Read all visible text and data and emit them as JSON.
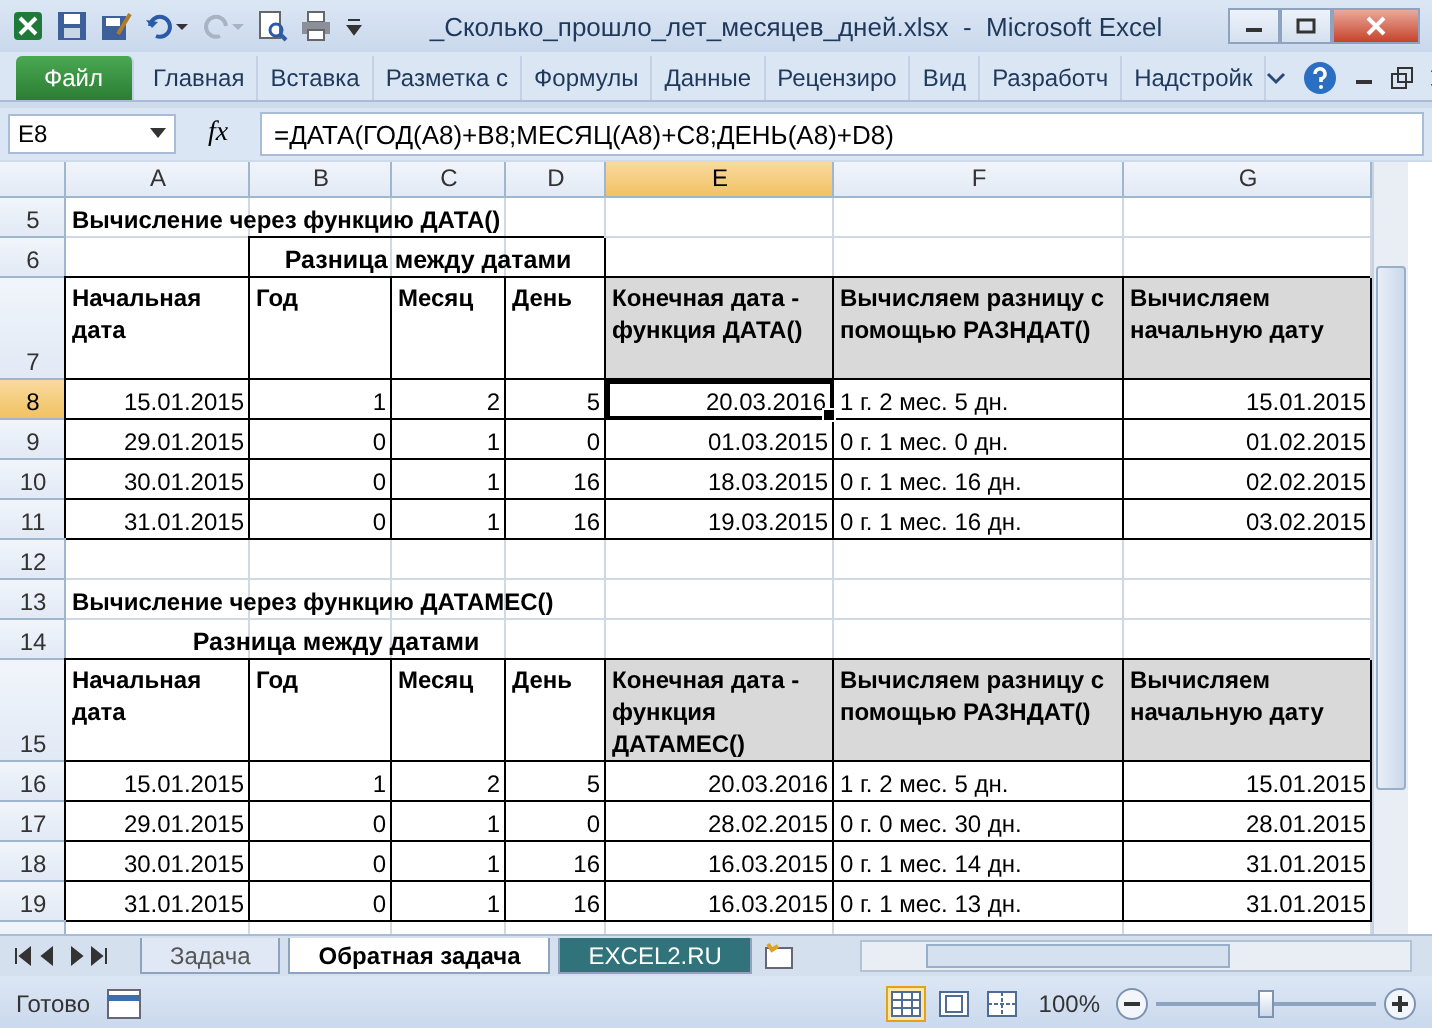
{
  "window": {
    "title": "_Сколько_прошло_лет_месяцев_дней.xlsx  -  Microsoft Excel"
  },
  "ribbon_tabs": [
    {
      "label": "Файл",
      "kind": "file",
      "selected": false
    },
    {
      "label": "Главная",
      "kind": "tab",
      "selected": false
    },
    {
      "label": "Вставка",
      "kind": "tab",
      "selected": false
    },
    {
      "label": "Разметка с",
      "kind": "tab",
      "selected": false
    },
    {
      "label": "Формулы",
      "kind": "tab",
      "selected": false
    },
    {
      "label": "Данные",
      "kind": "tab",
      "selected": false
    },
    {
      "label": "Рецензиро",
      "kind": "tab",
      "selected": false
    },
    {
      "label": "Вид",
      "kind": "tab",
      "selected": false
    },
    {
      "label": "Разработч",
      "kind": "tab",
      "selected": false
    },
    {
      "label": "Надстройк",
      "kind": "tab",
      "selected": false
    }
  ],
  "formula_bar": {
    "name_box": "E8",
    "fx": "fx",
    "formula": "=ДАТА(ГОД(A8)+B8;МЕСЯЦ(A8)+C8;ДЕНЬ(A8)+D8)"
  },
  "columns": [
    {
      "label": "A",
      "selected": false
    },
    {
      "label": "B",
      "selected": false
    },
    {
      "label": "C",
      "selected": false
    },
    {
      "label": "D",
      "selected": false
    },
    {
      "label": "E",
      "selected": true
    },
    {
      "label": "F",
      "selected": false
    },
    {
      "label": "G",
      "selected": false
    }
  ],
  "rows": [
    {
      "number": "5",
      "kind": "title",
      "selected": false,
      "text": "Вычисление через функцию ДАТА()"
    },
    {
      "number": "6",
      "kind": "group_boxed",
      "selected": false,
      "text": "Разница между датами"
    },
    {
      "number": "7",
      "kind": "header",
      "selected": false,
      "cells": [
        {
          "text": "Начальная дата",
          "shaded": false
        },
        {
          "text": "Год",
          "shaded": false
        },
        {
          "text": "Месяц",
          "shaded": false
        },
        {
          "text": "День",
          "shaded": false
        },
        {
          "text": "Конечная дата - функция ДАТА()",
          "shaded": true
        },
        {
          "text": "Вычисляем разницу с помощью РАЗНДАТ()",
          "shaded": true
        },
        {
          "text": "Вычисляем начальную дату",
          "shaded": true
        }
      ]
    },
    {
      "number": "8",
      "kind": "data",
      "selected": true,
      "cells": [
        {
          "text": "15.01.2015",
          "selected": false
        },
        {
          "text": "1",
          "selected": false
        },
        {
          "text": "2",
          "selected": false
        },
        {
          "text": "5",
          "selected": false
        },
        {
          "text": "20.03.2016",
          "selected": true
        },
        {
          "text": "1 г. 2 мес. 5 дн.",
          "selected": false
        },
        {
          "text": "15.01.2015",
          "selected": false
        }
      ]
    },
    {
      "number": "9",
      "kind": "data",
      "selected": false,
      "cells": [
        {
          "text": "29.01.2015",
          "selected": false
        },
        {
          "text": "0",
          "selected": false
        },
        {
          "text": "1",
          "selected": false
        },
        {
          "text": "0",
          "selected": false
        },
        {
          "text": "01.03.2015",
          "selected": false
        },
        {
          "text": "0 г. 1 мес. 0 дн.",
          "selected": false
        },
        {
          "text": "01.02.2015",
          "selected": false
        }
      ]
    },
    {
      "number": "10",
      "kind": "data",
      "selected": false,
      "cells": [
        {
          "text": "30.01.2015",
          "selected": false
        },
        {
          "text": "0",
          "selected": false
        },
        {
          "text": "1",
          "selected": false
        },
        {
          "text": "16",
          "selected": false
        },
        {
          "text": "18.03.2015",
          "selected": false
        },
        {
          "text": "0 г. 1 мес. 16 дн.",
          "selected": false
        },
        {
          "text": "02.02.2015",
          "selected": false
        }
      ]
    },
    {
      "number": "11",
      "kind": "data",
      "selected": false,
      "cells": [
        {
          "text": "31.01.2015",
          "selected": false
        },
        {
          "text": "0",
          "selected": false
        },
        {
          "text": "1",
          "selected": false
        },
        {
          "text": "16",
          "selected": false
        },
        {
          "text": "19.03.2015",
          "selected": false
        },
        {
          "text": "0 г. 1 мес. 16 дн.",
          "selected": false
        },
        {
          "text": "03.02.2015",
          "selected": false
        }
      ]
    },
    {
      "number": "12",
      "kind": "empty",
      "selected": false
    },
    {
      "number": "13",
      "kind": "title",
      "selected": false,
      "text": "Вычисление через функцию ДАТАМЕС()"
    },
    {
      "number": "14",
      "kind": "group",
      "selected": false,
      "text": "Разница между датами"
    },
    {
      "number": "15",
      "kind": "header",
      "selected": false,
      "cells": [
        {
          "text": "Начальная дата",
          "shaded": false
        },
        {
          "text": "Год",
          "shaded": false
        },
        {
          "text": "Месяц",
          "shaded": false
        },
        {
          "text": "День",
          "shaded": false
        },
        {
          "text": "Конечная дата - функция ДАТАМЕС()",
          "shaded": true
        },
        {
          "text": "Вычисляем разницу с помощью РАЗНДАТ()",
          "shaded": true
        },
        {
          "text": "Вычисляем начальную дату",
          "shaded": true
        }
      ]
    },
    {
      "number": "16",
      "kind": "data",
      "selected": false,
      "cells": [
        {
          "text": "15.01.2015",
          "selected": false
        },
        {
          "text": "1",
          "selected": false
        },
        {
          "text": "2",
          "selected": false
        },
        {
          "text": "5",
          "selected": false
        },
        {
          "text": "20.03.2016",
          "selected": false
        },
        {
          "text": "1 г. 2 мес. 5 дн.",
          "selected": false
        },
        {
          "text": "15.01.2015",
          "selected": false
        }
      ]
    },
    {
      "number": "17",
      "kind": "data",
      "selected": false,
      "cells": [
        {
          "text": "29.01.2015",
          "selected": false
        },
        {
          "text": "0",
          "selected": false
        },
        {
          "text": "1",
          "selected": false
        },
        {
          "text": "0",
          "selected": false
        },
        {
          "text": "28.02.2015",
          "selected": false
        },
        {
          "text": "0 г. 0 мес. 30 дн.",
          "selected": false
        },
        {
          "text": "28.01.2015",
          "selected": false
        }
      ]
    },
    {
      "number": "18",
      "kind": "data",
      "selected": false,
      "cells": [
        {
          "text": "30.01.2015",
          "selected": false
        },
        {
          "text": "0",
          "selected": false
        },
        {
          "text": "1",
          "selected": false
        },
        {
          "text": "16",
          "selected": false
        },
        {
          "text": "16.03.2015",
          "selected": false
        },
        {
          "text": "0 г. 1 мес. 14 дн.",
          "selected": false
        },
        {
          "text": "31.01.2015",
          "selected": false
        }
      ]
    },
    {
      "number": "19",
      "kind": "data",
      "selected": false,
      "cells": [
        {
          "text": "31.01.2015",
          "selected": false
        },
        {
          "text": "0",
          "selected": false
        },
        {
          "text": "1",
          "selected": false
        },
        {
          "text": "16",
          "selected": false
        },
        {
          "text": "16.03.2015",
          "selected": false
        },
        {
          "text": "0 г. 1 мес. 13 дн.",
          "selected": false
        },
        {
          "text": "31.01.2015",
          "selected": false
        }
      ]
    }
  ],
  "sheet_tabs": [
    {
      "label": "Задача",
      "selected": false
    },
    {
      "label": "Обратная задача",
      "selected": true
    },
    {
      "label": "EXCEL2.RU",
      "selected": false,
      "color": "#31737b"
    }
  ],
  "status_bar": {
    "status": "Готово",
    "zoom": "100%",
    "zoom_slider": {
      "level": 0.5
    },
    "views": [
      {
        "kind": "normal",
        "selected": true
      },
      {
        "kind": "page_layout",
        "selected": false
      },
      {
        "kind": "page_break",
        "selected": false
      }
    ]
  }
}
